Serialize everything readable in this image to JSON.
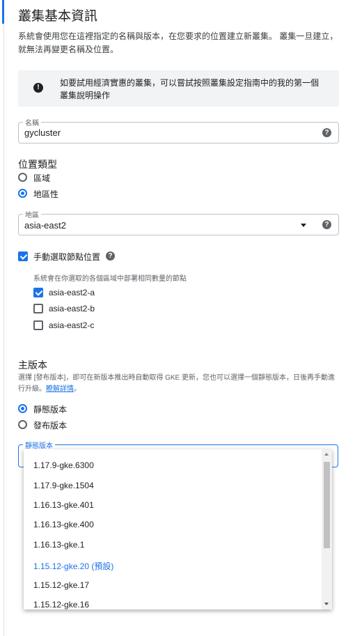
{
  "header": {
    "title": "叢集基本資訊",
    "description": "系統會使用您在這裡指定的名稱與版本，在您要求的位置建立新叢集。 叢集一旦建立，就無法再變更名稱及位置。"
  },
  "info_banner": {
    "icon": "info-icon",
    "text": "如要試用經濟實惠的叢集，可以嘗試按照叢集設定指南中的我的第一個叢集說明操作"
  },
  "name_field": {
    "label": "名稱",
    "value": "gycluster",
    "help_icon": "?"
  },
  "location_type": {
    "title": "位置類型",
    "options": [
      {
        "label": "區域",
        "checked": false
      },
      {
        "label": "地區性",
        "checked": true
      }
    ]
  },
  "region_field": {
    "label": "地區",
    "value": "asia-east2",
    "help_icon": "?"
  },
  "node_locations": {
    "label": "手動選取節點位置",
    "checked": true,
    "help_icon": "?",
    "hint": "系統會在你選取的各個區域中部署相同數量的節點",
    "zones": [
      {
        "label": "asia-east2-a",
        "checked": true
      },
      {
        "label": "asia-east2-b",
        "checked": false
      },
      {
        "label": "asia-east2-c",
        "checked": false
      }
    ]
  },
  "master_version": {
    "title": "主版本",
    "description": "選擇 [發布版本]，即可在新版本推出時自動取得 GKE 更新，您也可以選擇一個靜態版本，日後再手動進行升級。",
    "learn_more": "瞭解詳情",
    "suffix": "。",
    "options": [
      {
        "label": "靜態版本",
        "checked": true
      },
      {
        "label": "發布版本",
        "checked": false
      }
    ],
    "static_field_label": "靜態版本",
    "dropdown_items": [
      "1.17.9-gke.6300",
      "1.17.9-gke.1504",
      "1.16.13-gke.401",
      "1.16.13-gke.400",
      "1.16.13-gke.1",
      "1.15.12-gke.20 (預設)",
      "1.15.12-gke.17",
      "1.15.12-gke.16"
    ],
    "selected_index": 5
  },
  "colors": {
    "accent": "#1a73e8",
    "text": "#202124",
    "secondary_text": "#5f6368",
    "banner_bg": "#f1f3f4"
  }
}
